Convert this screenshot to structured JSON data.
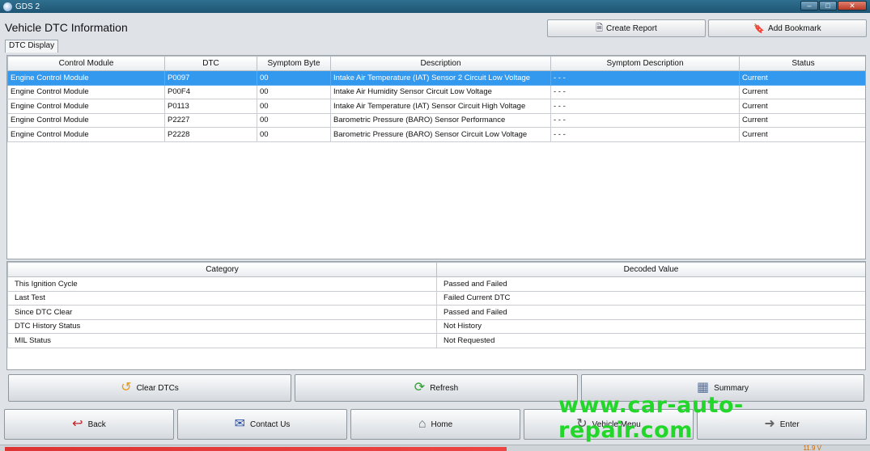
{
  "window": {
    "title": "GDS 2"
  },
  "header": {
    "title": "Vehicle DTC Information",
    "create_report": "Create Report",
    "add_bookmark": "Add Bookmark"
  },
  "tab": {
    "label": "DTC Display"
  },
  "dtc_table": {
    "columns": [
      "Control Module",
      "DTC",
      "Symptom Byte",
      "Description",
      "Symptom Description",
      "Status"
    ],
    "rows": [
      [
        "Engine Control Module",
        "P0097",
        "00",
        "Intake Air Temperature (IAT) Sensor 2 Circuit Low Voltage",
        "- - -",
        "Current"
      ],
      [
        "Engine Control Module",
        "P00F4",
        "00",
        "Intake Air Humidity Sensor Circuit Low Voltage",
        "- - -",
        "Current"
      ],
      [
        "Engine Control Module",
        "P0113",
        "00",
        "Intake Air Temperature (IAT) Sensor Circuit High Voltage",
        "- - -",
        "Current"
      ],
      [
        "Engine Control Module",
        "P2227",
        "00",
        "Barometric Pressure (BARO) Sensor Performance",
        "- - -",
        "Current"
      ],
      [
        "Engine Control Module",
        "P2228",
        "00",
        "Barometric Pressure (BARO) Sensor Circuit Low Voltage",
        "- - -",
        "Current"
      ]
    ]
  },
  "status_table": {
    "columns": [
      "Category",
      "Decoded Value"
    ],
    "rows": [
      [
        "This Ignition Cycle",
        "Passed and Failed"
      ],
      [
        "Last Test",
        "Failed Current DTC"
      ],
      [
        "Since DTC Clear",
        "Passed and Failed"
      ],
      [
        "DTC History Status",
        "Not History"
      ],
      [
        "MIL Status",
        "Not Requested"
      ]
    ]
  },
  "actions": {
    "clear_dtcs": "Clear DTCs",
    "refresh": "Refresh",
    "summary": "Summary"
  },
  "nav": {
    "back": "Back",
    "contact_us": "Contact Us",
    "home": "Home",
    "vehicle_menu": "Vehicle Menu",
    "enter": "Enter"
  },
  "watermark": "www.car-auto-repair.com",
  "statusbar": {
    "voltage": "11.9 V"
  },
  "colors": {
    "selection": "#3399ee",
    "watermark": "#22d62a",
    "titlebar": "#2f6f8f"
  }
}
